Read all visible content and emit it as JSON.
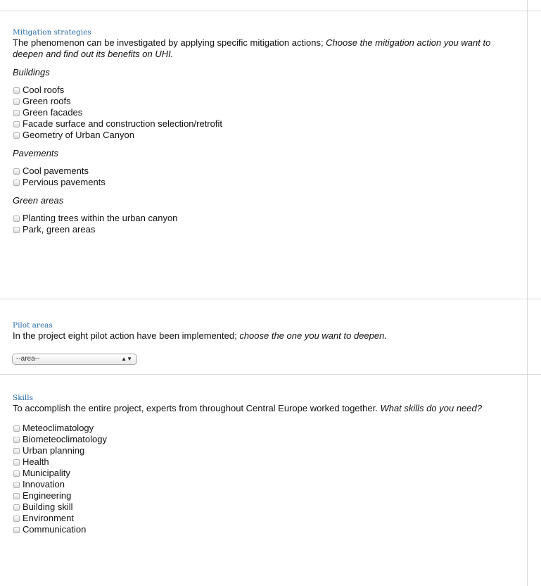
{
  "mitigation": {
    "title": "Mitigation strategies",
    "intro_plain": "The phenomenon can be investigated by applying specific mitigation actions; ",
    "intro_italic": "Choose the mitigation action you want to deepen and find out its benefits on UHI.",
    "groups": [
      {
        "title": "Buildings",
        "options": [
          "Cool roofs",
          "Green roofs",
          "Green facades",
          "Facade surface and construction selection/retrofit",
          "Geometry of Urban Canyon"
        ]
      },
      {
        "title": "Pavements",
        "options": [
          "Cool pavements",
          "Pervious pavements"
        ]
      },
      {
        "title": "Green areas",
        "options": [
          "Planting trees within the urban canyon",
          "Park, green areas"
        ]
      }
    ]
  },
  "pilot": {
    "title": "Pilot areas",
    "intro_plain": "In the project eight pilot action have been implemented; ",
    "intro_italic": "choose the one you want to deepen.",
    "select_value": "--area--"
  },
  "skills": {
    "title": "Skills",
    "intro_plain": "To accomplish the entire project, experts from throughout Central Europe worked together. ",
    "intro_italic": "What skills do you need?",
    "options": [
      "Meteoclimatology",
      "Biometeoclimatology",
      "Urban planning",
      "Health",
      "Municipality",
      "Innovation",
      "Engineering",
      "Building skill",
      "Environment",
      "Communication"
    ]
  },
  "icons": {
    "checkbox": "checkbox-icon",
    "select_arrow": "select-updown-arrow-icon"
  },
  "colors": {
    "section_title": "#2a6ca8",
    "divider": "#d9d9d9"
  }
}
